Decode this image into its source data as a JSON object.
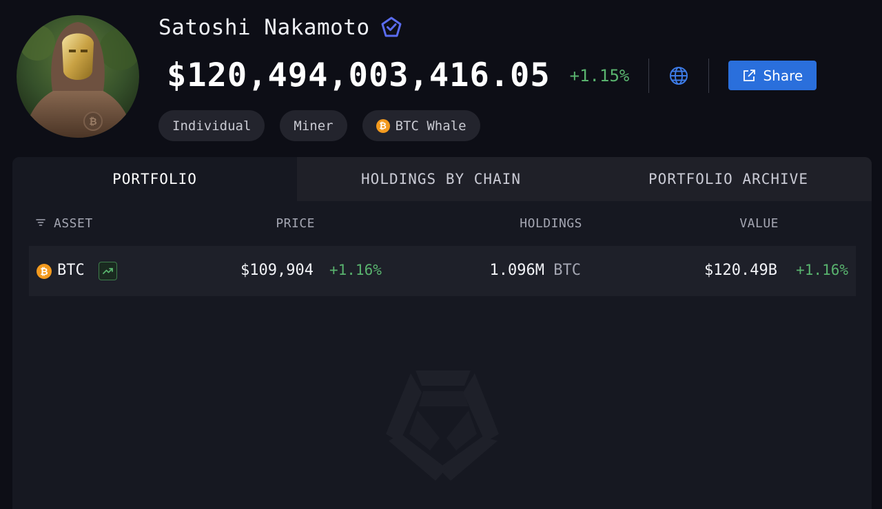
{
  "profile": {
    "name": "Satoshi Nakamoto",
    "total_value": "$120,494,003,416.05",
    "total_change": "+1.15%",
    "share_label": "Share",
    "tags": [
      {
        "label": "Individual"
      },
      {
        "label": "Miner"
      },
      {
        "label": "BTC Whale",
        "icon": "btc-coin-icon"
      }
    ]
  },
  "tabs": [
    {
      "label": "PORTFOLIO",
      "active": true
    },
    {
      "label": "HOLDINGS BY CHAIN",
      "active": false
    },
    {
      "label": "PORTFOLIO ARCHIVE",
      "active": false
    }
  ],
  "table": {
    "headers": {
      "asset": "ASSET",
      "price": "PRICE",
      "holdings": "HOLDINGS",
      "value": "VALUE"
    },
    "rows": [
      {
        "symbol": "BTC",
        "coin_glyph": "₿",
        "price": "$109,904",
        "price_change": "+1.16%",
        "holdings": "1.096M",
        "holdings_unit": "BTC",
        "value": "$120.49B",
        "value_change": "+1.16%"
      }
    ]
  },
  "colors": {
    "background": "#0d0e16",
    "panel": "#161821",
    "positive": "#59b36e",
    "accent_blue": "#2a6fdc",
    "btc_orange": "#f39a1e"
  }
}
